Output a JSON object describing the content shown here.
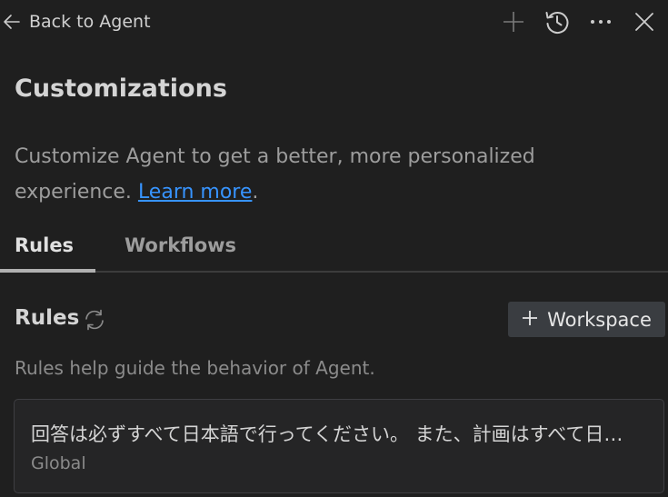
{
  "header": {
    "back_label": "Back to Agent",
    "icons": [
      "arrow-left-icon",
      "plus-icon",
      "history-icon",
      "more-icon",
      "close-icon"
    ]
  },
  "page": {
    "title": "Customizations",
    "description": "Customize Agent to get a better, more personalized experience.",
    "learn_more": "Learn more",
    "description_end": "."
  },
  "tabs": [
    {
      "label": "Rules",
      "active": true
    },
    {
      "label": "Workflows",
      "active": false
    }
  ],
  "rules_section": {
    "title": "Rules",
    "add_button_label": "Workspace",
    "description": "Rules help guide the behavior of Agent.",
    "items": [
      {
        "text": "回答は必ずすべて日本語で行ってください。 また、計画はすべて日本語で作成してください。",
        "scope": "Global"
      }
    ]
  },
  "colors": {
    "background": "#1f1f1f",
    "link": "#3794ff",
    "button_bg": "#3a3d41",
    "card_bg": "#252526"
  }
}
